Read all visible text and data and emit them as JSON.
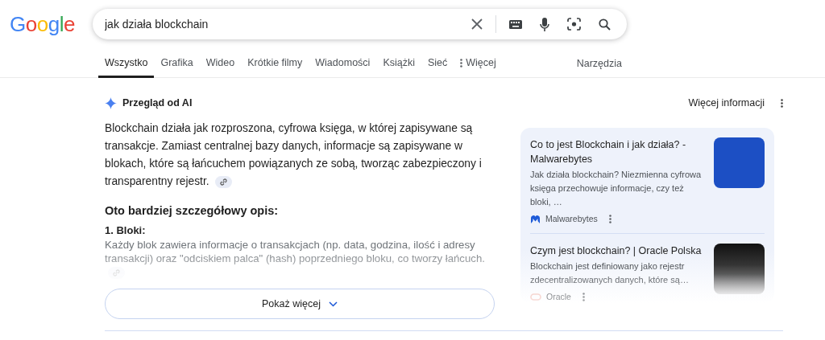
{
  "logo": "Google",
  "search": {
    "value": "jak działa blockchain"
  },
  "tabs": [
    {
      "label": "Wszystko",
      "selected": true,
      "kind": "tab"
    },
    {
      "label": "Grafika",
      "selected": false,
      "kind": "tab"
    },
    {
      "label": "Wideo",
      "selected": false,
      "kind": "tab"
    },
    {
      "label": "Krótkie filmy",
      "selected": false,
      "kind": "tab"
    },
    {
      "label": "Wiadomości",
      "selected": false,
      "kind": "tab"
    },
    {
      "label": "Książki",
      "selected": false,
      "kind": "tab"
    },
    {
      "label": "Sieć",
      "selected": false,
      "kind": "tab"
    },
    {
      "label": "Więcej",
      "selected": false,
      "kind": "menu"
    }
  ],
  "tools": "Narzędzia",
  "ai_overview": {
    "title": "Przegląd od AI",
    "more_info": "Więcej informacji",
    "summary": "Blockchain działa jak rozproszona, cyfrowa księga, w której zapisywane są transakcje. Zamiast centralnej bazy danych, informacje są zapisywane w blokach, które są łańcuchem powiązanych ze sobą, tworząc zabezpieczony i transparentny rejestr.",
    "subheading": "Oto bardziej szczegółowy opis:",
    "items": [
      {
        "heading": "1. Bloki:",
        "text": "Każdy blok zawiera informacje o transakcjach (np. data, godzina, ilość i adresy transakcji) oraz \"odciskiem palca\" (hash) poprzedniego bloku, co tworzy łańcuch."
      }
    ],
    "show_more": "Pokaż więcej"
  },
  "sources": [
    {
      "title": "Co to jest Blockchain i jak działa? - Malwarebytes",
      "snippet": "Jak działa blockchain? Niezmienna cyfrowa księga przechowuje informacje, czy też bloki, …",
      "site": "Malwarebytes",
      "faded": false
    },
    {
      "title": "Czym jest blockchain? | Oracle Polska",
      "snippet": "Blockchain jest definiowany jako rejestr zdecentralizowanych danych, które są…",
      "site": "Oracle",
      "faded": true
    }
  ]
}
